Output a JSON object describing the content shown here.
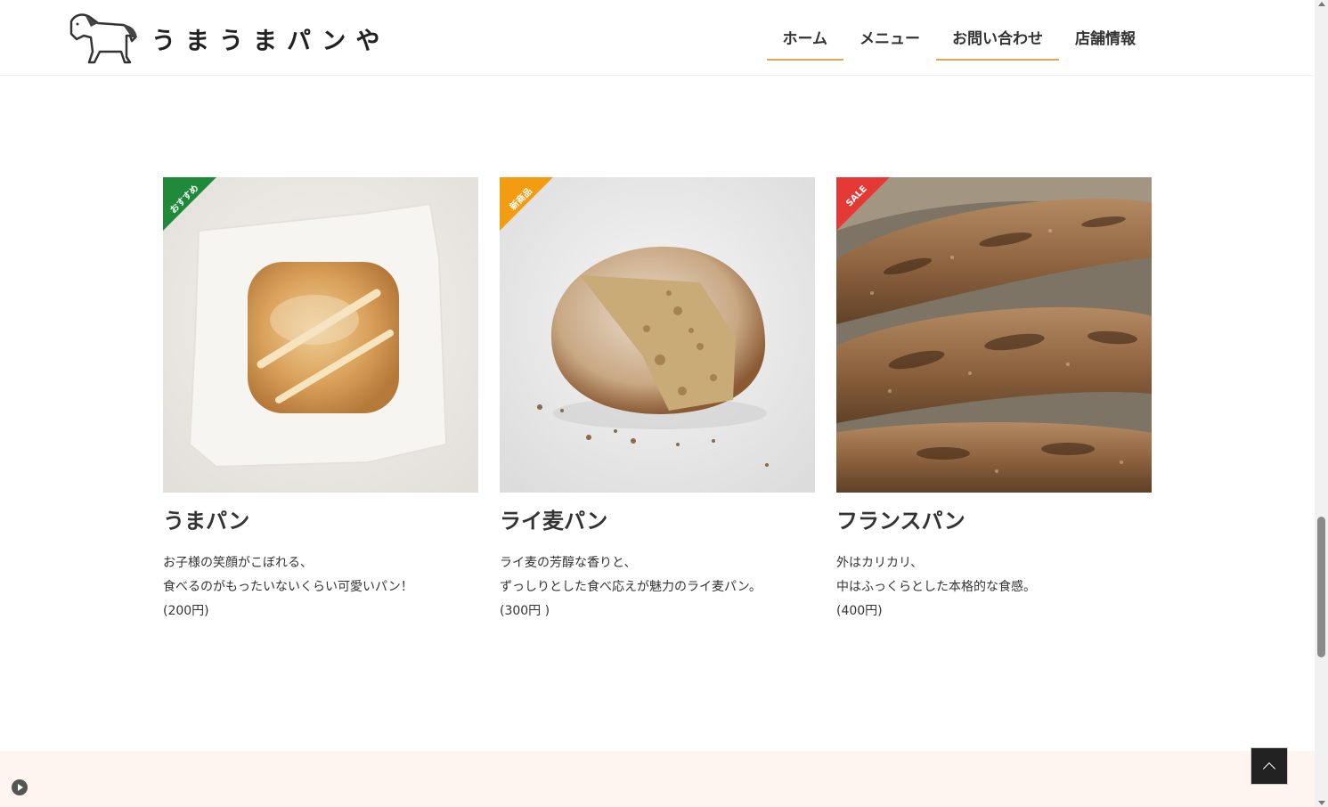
{
  "site": {
    "logo_text": "うまうまパンや"
  },
  "nav": [
    {
      "label": "ホーム",
      "active": true
    },
    {
      "label": "メニュー",
      "active": false
    },
    {
      "label": "お問い合わせ",
      "active": true
    },
    {
      "label": "店舗情報",
      "active": false
    }
  ],
  "products": [
    {
      "badge": "おすすめ",
      "badge_color": "#1f8a3a",
      "name": "うまパン",
      "desc_line1": "お子様の笑顔がこぼれる、",
      "desc_line2": "食べるのがもったいないくらい可愛いパン！",
      "price": "(200円)"
    },
    {
      "badge": "新商品",
      "badge_color": "#f39c12",
      "name": "ライ麦パン",
      "desc_line1": "ライ麦の芳醇な香りと、",
      "desc_line2": "ずっしりとした食べ応えが魅力のライ麦パン。",
      "price": "(300円 )"
    },
    {
      "badge": "SALE",
      "badge_color": "#e53935",
      "name": "フランスパン",
      "desc_line1": "外はカリカリ、",
      "desc_line2": "中はふっくらとした本格的な食感。",
      "price": "(400円)"
    }
  ],
  "colors": {
    "accent": "#e7a54f",
    "footer_bg": "#fff5f0"
  },
  "icons": {
    "pagetop": "chevron-up-icon",
    "play": "play-icon",
    "logo": "horse-icon"
  }
}
